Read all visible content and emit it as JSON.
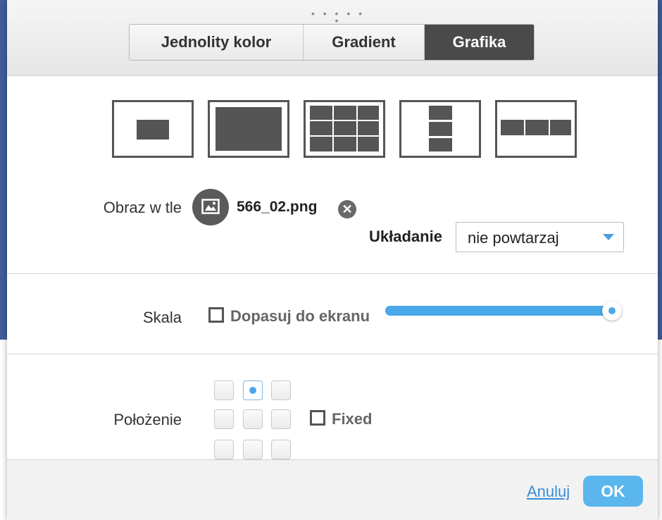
{
  "tabs": [
    {
      "label": "Jednolity kolor",
      "active": false
    },
    {
      "label": "Gradient",
      "active": false
    },
    {
      "label": "Grafika",
      "active": true
    }
  ],
  "layouts": [
    "center",
    "fill",
    "tile",
    "tile-vertical",
    "tile-horizontal"
  ],
  "background_image": {
    "label": "Obraz w tle",
    "file_name": "566_02.png",
    "icon": "image-icon"
  },
  "tiling": {
    "label": "Układanie",
    "value": "nie powtarzaj"
  },
  "scale": {
    "label": "Skala",
    "fit_label": "Dopasuj do ekranu",
    "fit_checked": false,
    "slider_value_percent": 100
  },
  "position": {
    "label": "Położenie",
    "selected": "top-center",
    "fixed_label": "Fixed",
    "fixed_checked": false
  },
  "footer": {
    "cancel_label": "Anuluj",
    "ok_label": "OK"
  },
  "colors": {
    "accent": "#4aa7e8",
    "active_tab": "#4a4a4a",
    "ok_button": "#5bb6ee"
  }
}
